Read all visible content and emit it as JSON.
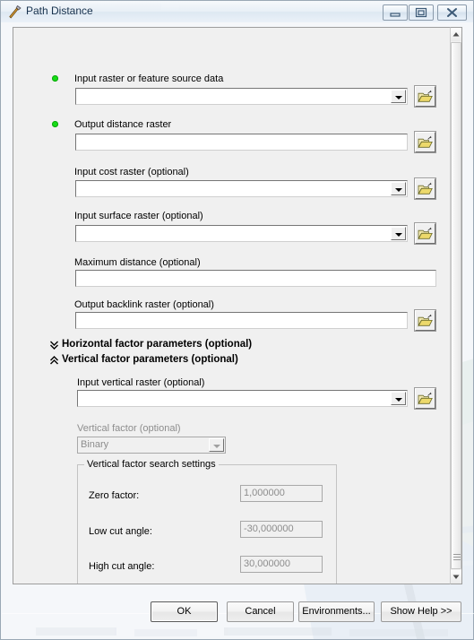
{
  "window": {
    "title": "Path Distance",
    "icon": "hammer-tool-icon",
    "controls": {
      "minimize": "Minimize",
      "maximize": "Restore",
      "close": "Close"
    }
  },
  "form": {
    "fields": [
      {
        "id": "input-raster-or-feature-source-data",
        "label": "Input raster or feature source data",
        "required": true,
        "value": "",
        "has_dropdown": true,
        "has_browse": true,
        "enabled": true
      },
      {
        "id": "output-distance-raster",
        "label": "Output distance raster",
        "required": true,
        "value": "",
        "has_dropdown": false,
        "has_browse": true,
        "enabled": true
      },
      {
        "id": "input-cost-raster",
        "label": "Input cost raster (optional)",
        "required": false,
        "value": "",
        "has_dropdown": true,
        "has_browse": true,
        "enabled": true
      },
      {
        "id": "input-surface-raster",
        "label": "Input surface raster (optional)",
        "required": false,
        "value": "",
        "has_dropdown": true,
        "has_browse": true,
        "enabled": true
      },
      {
        "id": "maximum-distance",
        "label": "Maximum distance (optional)",
        "required": false,
        "value": "",
        "has_dropdown": false,
        "has_browse": false,
        "enabled": true
      },
      {
        "id": "output-backlink-raster",
        "label": "Output backlink raster (optional)",
        "required": false,
        "value": "",
        "has_dropdown": false,
        "has_browse": true,
        "enabled": true
      }
    ],
    "sections": [
      {
        "id": "horizontal-factor-parameters",
        "label": "Horizontal factor parameters (optional)",
        "expanded": false,
        "chevron": "chevron-double-down-icon"
      },
      {
        "id": "vertical-factor-parameters",
        "label": "Vertical factor parameters (optional)",
        "expanded": true,
        "chevron": "chevron-double-up-icon"
      }
    ],
    "vertical_section": {
      "input_vertical_raster": {
        "label": "Input vertical raster (optional)",
        "value": "",
        "has_dropdown": true,
        "has_browse": true,
        "enabled": true
      },
      "vertical_factor": {
        "label": "Vertical factor (optional)",
        "value": "Binary",
        "enabled": false
      },
      "search_settings": {
        "legend": "Vertical factor search settings",
        "rows": [
          {
            "id": "zero-factor",
            "label": "Zero factor:",
            "value": "1,000000",
            "enabled": false
          },
          {
            "id": "low-cut-angle",
            "label": "Low cut angle:",
            "value": "-30,000000",
            "enabled": false
          },
          {
            "id": "high-cut-angle",
            "label": "High cut angle:",
            "value": "30,000000",
            "enabled": false
          }
        ]
      }
    }
  },
  "buttons": {
    "ok": "OK",
    "cancel": "Cancel",
    "environments": "Environments...",
    "show_help": "Show Help >>"
  },
  "colors": {
    "required_dot": "#16dc16",
    "dialog_face": "#f0f0f0",
    "title_text": "#16314d",
    "disabled_text": "#8d8d8d",
    "folder_icon": "#e8d86a"
  }
}
